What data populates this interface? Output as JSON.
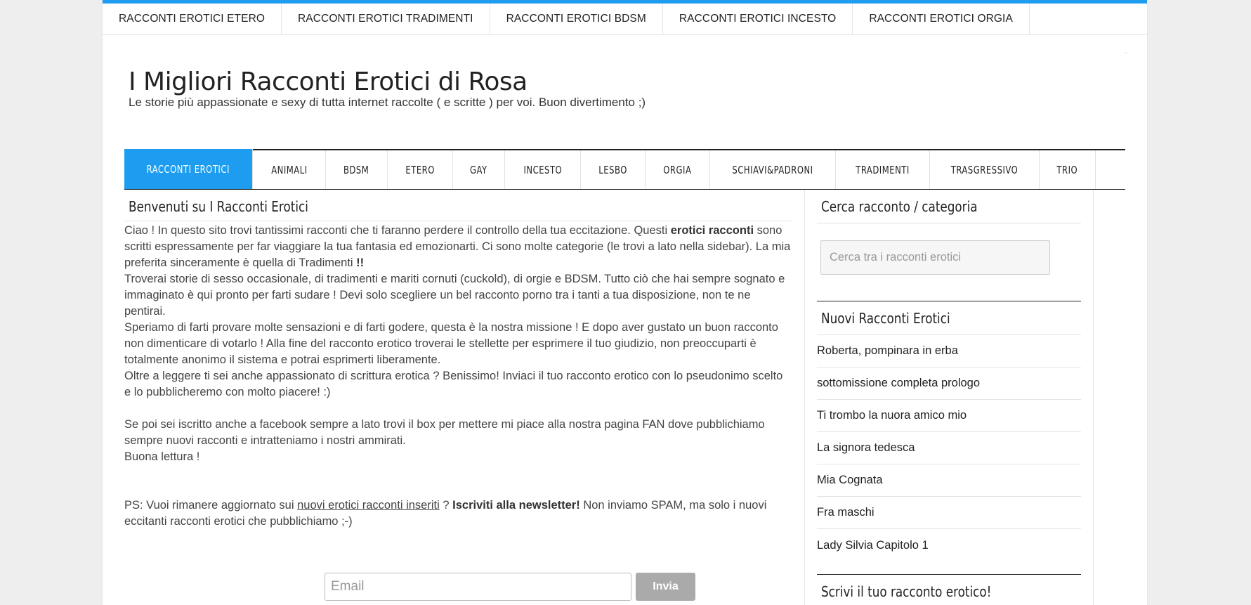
{
  "top_nav": {
    "items": [
      {
        "label": "RACCONTI EROTICI ETERO"
      },
      {
        "label": "RACCONTI EROTICI TRADIMENTI"
      },
      {
        "label": "RACCONTI EROTICI BDSM"
      },
      {
        "label": "RACCONTI EROTICI INCESTO"
      },
      {
        "label": "RACCONTI EROTICI ORGIA"
      }
    ]
  },
  "header": {
    "title": "I Migliori Racconti Erotici di Rosa",
    "description": "Le storie più appassionate e sexy di tutta internet raccolte ( e scritte ) per voi. Buon divertimento ;)"
  },
  "main_nav": {
    "items": [
      {
        "label": "RACCONTI EROTICI",
        "active": true
      },
      {
        "label": "ANIMALI"
      },
      {
        "label": "BDSM"
      },
      {
        "label": "ETERO"
      },
      {
        "label": "GAY"
      },
      {
        "label": "INCESTO"
      },
      {
        "label": "LESBO"
      },
      {
        "label": "ORGIA"
      },
      {
        "label": "SCHIAVI&PADRONI"
      },
      {
        "label": "TRADIMENTI"
      },
      {
        "label": "TRASGRESSIVO"
      },
      {
        "label": "TRIO"
      }
    ]
  },
  "content": {
    "heading": "Benvenuti su I Racconti Erotici",
    "p1a": "Ciao ! In questo sito trovi tantissimi racconti che ti faranno perdere il controllo della tua eccitazione. Questi ",
    "p1b": "erotici racconti",
    "p1c": " sono scritti espressamente per far viaggiare la tua fantasia ed emozionarti. Ci sono molte categorie (le trovi a lato nella sidebar). La mia preferita sinceramente è quella di Tradimenti ",
    "p1d": "!!",
    "p2": "Troverai storie di sesso occasionale, di tradimenti e mariti cornuti (cuckold), di orgie e BDSM. Tutto ciò che hai sempre sognato e immaginato è qui pronto per farti sudare ! Devi solo scegliere un bel racconto porno tra i tanti a tua disposizione, non te ne pentirai.",
    "p3": "Speriamo di farti provare molte sensazioni e di farti godere, questa è la nostra missione ! E dopo aver gustato un buon racconto non dimenticare di votarlo ! Alla fine del racconto erotico troverai le stellette per esprimere il tuo giudizio, non preoccuparti è totalmente anonimo il sistema e potrai esprimerti liberamente.",
    "p4": "Oltre a leggere ti sei anche appassionato di scrittura erotica ? Benissimo! Inviaci il tuo racconto erotico con lo pseudonimo scelto e lo pubblicheremo con molto piacere! :)",
    "p5": "Se poi sei iscritto anche a facebook sempre a lato trovi il box per mettere mi piace alla nostra pagina FAN dove pubblichiamo sempre nuovi racconti e intratteniamo i nostri ammirati.",
    "p6": "Buona lettura !",
    "ps_a": "PS: Vuoi rimanere aggiornato sui ",
    "ps_link": "nuovi erotici racconti inseriti",
    "ps_b": " ? ",
    "ps_bold": "Iscriviti alla newsletter!",
    "ps_c": " Non inviamo SPAM, ma solo i nuovi eccitanti racconti erotici che pubblichiamo ;-)"
  },
  "newsletter": {
    "email_placeholder": "Email",
    "submit_label": "Invia"
  },
  "sidebar": {
    "search_title": "Cerca racconto / categoria",
    "search_placeholder": "Cerca tra i racconti erotici",
    "recent_title": "Nuovi Racconti Erotici",
    "recent": [
      "Roberta, pompinara in erba",
      "sottomissione completa prologo",
      "Ti trombo la nuora amico mio",
      "La signora tedesca",
      "Mia Cognata",
      "Fra maschi",
      "Lady Silvia Capitolo 1"
    ],
    "write_title": "Scrivi il tuo racconto erotico!"
  },
  "colors": {
    "accent": "#1e9df0",
    "background": "#eeeeee",
    "button_gray": "#aaaaaa"
  }
}
